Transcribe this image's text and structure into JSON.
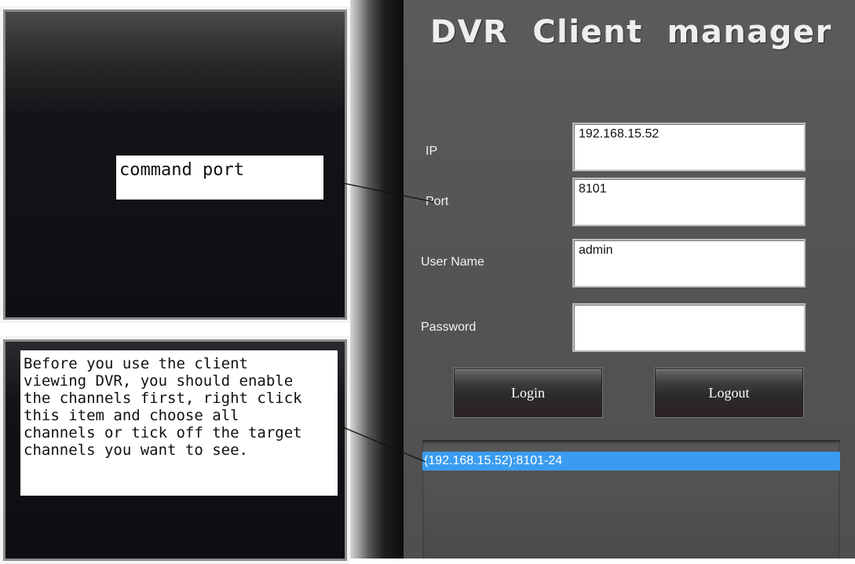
{
  "app": {
    "title": "DVR  Client  manager"
  },
  "login_form": {
    "ip_label": "IP",
    "ip_value": "192.168.15.52",
    "port_label": "Port",
    "port_value": "8101",
    "username_label": "User Name",
    "username_value": "admin",
    "password_label": "Password",
    "password_value": ""
  },
  "buttons": {
    "login_label": "Login",
    "logout_label": "Logout"
  },
  "device_list": {
    "items": [
      "(192.168.15.52):8101-24"
    ],
    "selected_color": "#3a9cf0"
  },
  "annotations": {
    "port_note": "command port",
    "channels_note": "Before you use the client\nviewing DVR, you should enable\nthe channels first, right click\nthis item and choose all\nchannels or tick off the target\nchannels you want to see."
  }
}
